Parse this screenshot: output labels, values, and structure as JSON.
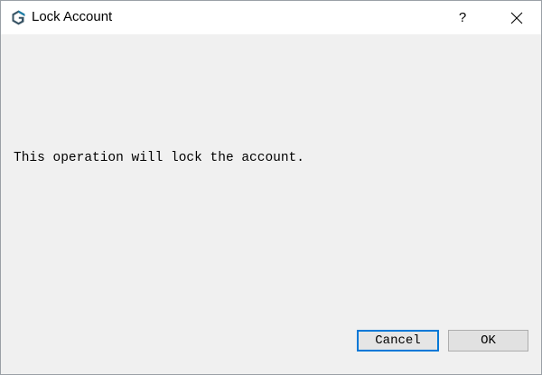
{
  "window": {
    "title": "Lock Account",
    "help_label": "?",
    "app_icon": "app-logo-icon",
    "close_icon": "close-icon"
  },
  "dialog": {
    "message": "This operation will lock the account."
  },
  "buttons": {
    "cancel_label": "Cancel",
    "ok_label": "OK"
  },
  "colors": {
    "focus_border": "#0078d7",
    "background": "#f0f0f0",
    "titlebar": "#ffffff"
  }
}
